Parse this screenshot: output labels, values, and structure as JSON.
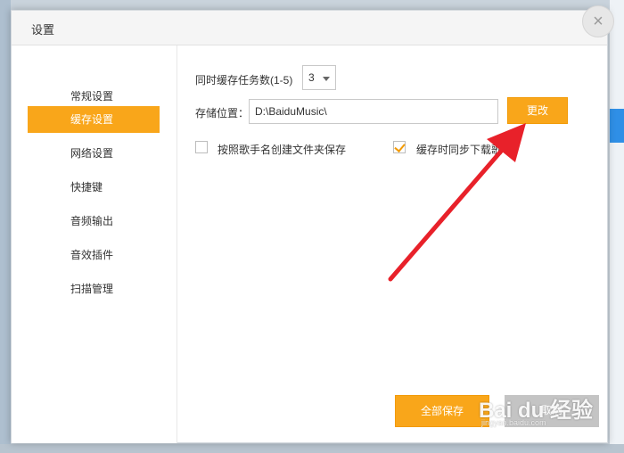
{
  "dialog": {
    "title": "设置",
    "close_symbol": "×"
  },
  "sidebar": {
    "items": [
      {
        "label": "常规设置",
        "active": false
      },
      {
        "label": "缓存设置",
        "active": true
      },
      {
        "label": "网络设置",
        "active": false
      },
      {
        "label": "快捷键",
        "active": false
      },
      {
        "label": "音频输出",
        "active": false
      },
      {
        "label": "音效插件",
        "active": false
      },
      {
        "label": "扫描管理",
        "active": false
      }
    ]
  },
  "cache": {
    "tasks_label": "同时缓存任务数(1-5)",
    "tasks_value": "3",
    "storage_label": "存储位置：",
    "storage_path": "D:\\BaiduMusic\\",
    "change_button": "更改",
    "option1_label": "按照歌手名创建文件夹保存",
    "option1_checked": false,
    "option2_label": "缓存时同步下载歌",
    "option2_checked": true
  },
  "footer": {
    "save_all": "全部保存",
    "cancel": "取消"
  },
  "watermark": {
    "text": "Bai du 经验",
    "sub": "jingyan.baidu.com"
  },
  "colors": {
    "accent": "#f9a61a",
    "arrow": "#e8212a"
  }
}
